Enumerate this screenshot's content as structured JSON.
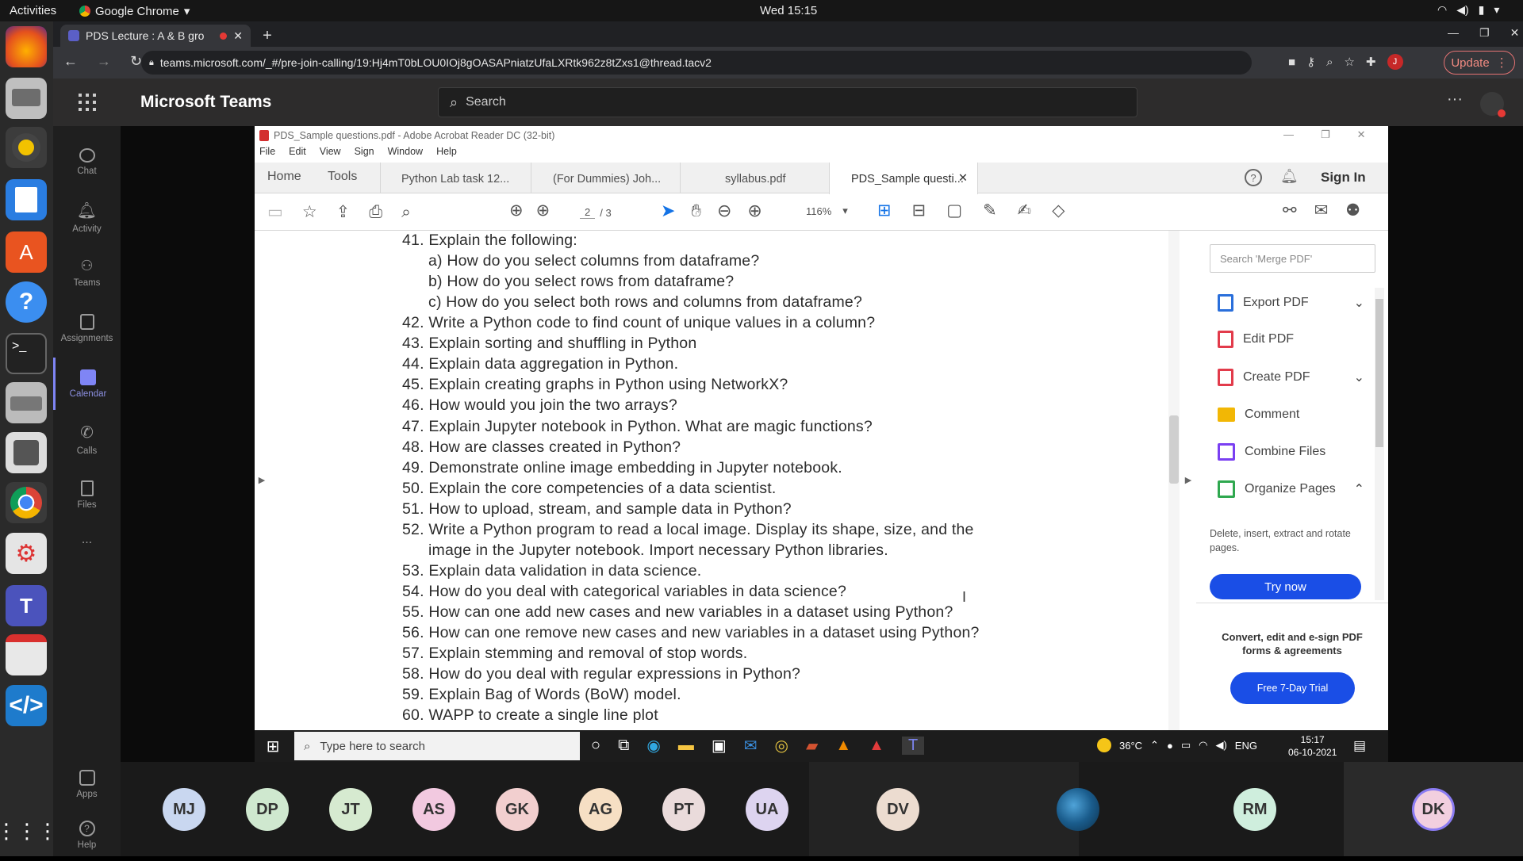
{
  "system": {
    "activities": "Activities",
    "app_name": "Google Chrome",
    "clock": "Wed 15:15"
  },
  "chrome": {
    "tab_title": "PDS Lecture : A & B gro",
    "url": "teams.microsoft.com/_#/pre-join-calling/19:Hj4mT0bLOU0IOj8gOASAPniatzUfaLXRtk962z8tZxs1@thread.tacv2",
    "update_label": "Update",
    "profile_initial": "J"
  },
  "teams": {
    "title": "Microsoft Teams",
    "search_placeholder": "Search",
    "rail": [
      {
        "label": "Chat",
        "icon": "chat-icon"
      },
      {
        "label": "Activity",
        "icon": "bell-icon"
      },
      {
        "label": "Teams",
        "icon": "teams-icon"
      },
      {
        "label": "Assignments",
        "icon": "assignments-icon"
      },
      {
        "label": "Calendar",
        "icon": "calendar-icon"
      },
      {
        "label": "Calls",
        "icon": "phone-icon"
      },
      {
        "label": "Files",
        "icon": "file-icon"
      }
    ],
    "more": "...",
    "apps_label": "Apps",
    "help_label": "Help"
  },
  "acrobat": {
    "window_title": "PDS_Sample questions.pdf - Adobe Acrobat Reader DC (32-bit)",
    "menu": [
      "File",
      "Edit",
      "View",
      "Sign",
      "Window",
      "Help"
    ],
    "nav": {
      "home": "Home",
      "tools": "Tools"
    },
    "tabs": [
      "Python Lab task 12...",
      "(For Dummies) Joh...",
      "syllabus.pdf",
      "PDS_Sample questi..."
    ],
    "sign_in": "Sign In",
    "page_current": "2",
    "page_total": "/ 3",
    "zoom": "116%",
    "lines": [
      "41. Explain the following:",
      "a)  How do you select columns from dataframe?",
      "b)  How do you select rows from dataframe?",
      "c)   How do you select both rows and columns from dataframe?",
      "42. Write a Python code to find count of unique values in a column?",
      "43. Explain sorting and shuffling in Python",
      "44. Explain data aggregation in Python.",
      "45. Explain creating graphs in Python using NetworkX?",
      "46. How would you join the two arrays?",
      "47. Explain Jupyter notebook in Python. What are magic functions?",
      "48. How are classes created in Python?",
      "49.  Demonstrate online image embedding in Jupyter notebook.",
      "50. Explain the core competencies of a data scientist.",
      "51.  How to upload, stream, and sample data in Python?",
      "52. Write a Python program to read a local image. Display its shape, size, and the",
      "image in the Jupyter notebook. Import necessary Python libraries.",
      "53. Explain data validation in data science.",
      "54. How do you deal with categorical variables in data science?",
      "55. How can one add new cases and new variables in a dataset using Python?",
      "56. How can one remove new cases and new variables in a dataset using Python?",
      "57. Explain stemming and removal of stop words.",
      "58. How do you deal with regular expressions in Python?",
      "59. Explain Bag of Words (BoW) model.",
      "60. WAPP to create a single line plot"
    ],
    "right_pane": {
      "search_placeholder": "Search 'Merge PDF'",
      "tools": [
        "Export PDF",
        "Edit PDF",
        "Create PDF",
        "Comment",
        "Combine Files",
        "Organize Pages"
      ],
      "organize_desc": "Delete, insert, extract and rotate pages.",
      "try_now": "Try now",
      "promo": "Convert, edit and e-sign PDF forms & agreements",
      "trial": "Free 7-Day Trial"
    },
    "colors": {
      "export": "#2a6fdb",
      "edit": "#e23b4b",
      "create": "#e23b4b",
      "comment": "#f2b705",
      "combine": "#7a3ff2",
      "organize": "#2fa84f"
    }
  },
  "windows": {
    "search_placeholder": "Type here to search",
    "weather": "36°C",
    "lang": "ENG",
    "time": "15:17",
    "date": "06-10-2021"
  },
  "participants": [
    "MJ",
    "DP",
    "JT",
    "AS",
    "GK",
    "AG",
    "PT",
    "UA",
    "DV",
    "RM",
    "DK"
  ]
}
